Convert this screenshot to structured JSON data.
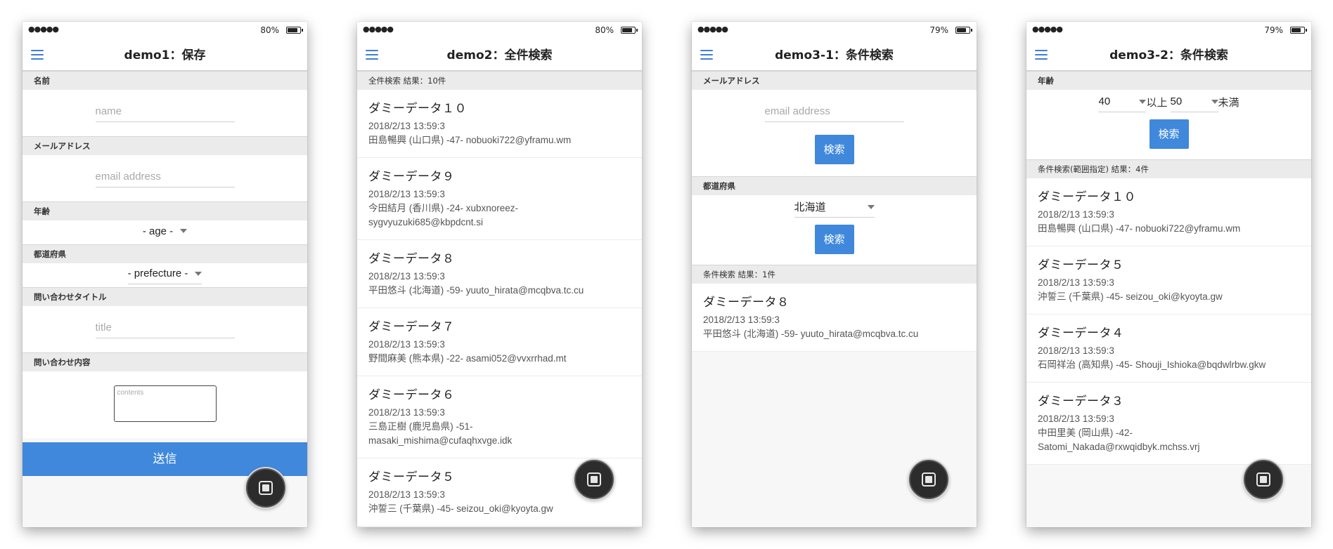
{
  "status": {
    "signal": "●●●●●"
  },
  "phones": [
    {
      "battery": "80%",
      "battery_level": 0.8,
      "title": "demo1：保存",
      "sections": {
        "name_label": "名前",
        "name_placeholder": "name",
        "email_label": "メールアドレス",
        "email_placeholder": "email address",
        "age_label": "年齢",
        "age_value": "- age -",
        "pref_label": "都道府県",
        "pref_value": "- prefecture -",
        "inq_title_label": "問い合わせタイトル",
        "inq_title_placeholder": "title",
        "inq_contents_label": "問い合わせ内容",
        "inq_contents_placeholder": "contents",
        "submit": "送信"
      }
    },
    {
      "battery": "80%",
      "battery_level": 0.8,
      "title": "demo2：全件検索",
      "result_header": "全件検索 結果：10件",
      "items": [
        {
          "name": "ダミーデータ１０",
          "date": "2018/2/13 13:59:3",
          "detail": "田島暢興 (山口県) -47- nobuoki722@yframu.wm"
        },
        {
          "name": "ダミーデータ９",
          "date": "2018/2/13 13:59:3",
          "detail": "今田結月 (香川県) -24- xubxnoreez-sygvyuzuki685@kbpdcnt.si"
        },
        {
          "name": "ダミーデータ８",
          "date": "2018/2/13 13:59:3",
          "detail": "平田悠斗 (北海道) -59- yuuto_hirata@mcqbva.tc.cu"
        },
        {
          "name": "ダミーデータ７",
          "date": "2018/2/13 13:59:3",
          "detail": "野間麻美 (熊本県) -22- asami052@vvxrrhad.mt"
        },
        {
          "name": "ダミーデータ６",
          "date": "2018/2/13 13:59:3",
          "detail": "三島正樹 (鹿児島県) -51- masaki_mishima@cufaqhxvge.idk"
        },
        {
          "name": "ダミーデータ５",
          "date": "2018/2/13 13:59:3",
          "detail": "沖誓三 (千葉県) -45- seizou_oki@kyoyta.gw"
        }
      ]
    },
    {
      "battery": "79%",
      "battery_level": 0.79,
      "title": "demo3-1：条件検索",
      "email_label": "メールアドレス",
      "email_placeholder": "email address",
      "search_btn": "検索",
      "pref_label": "都道府県",
      "pref_value": "北海道",
      "result_header": "条件検索 結果：1件",
      "items": [
        {
          "name": "ダミーデータ８",
          "date": "2018/2/13 13:59:3",
          "detail": "平田悠斗 (北海道) -59- yuuto_hirata@mcqbva.tc.cu"
        }
      ]
    },
    {
      "battery": "79%",
      "battery_level": 0.79,
      "title": "demo3-2：条件検索",
      "age_label": "年齢",
      "age_min": "40",
      "age_min_suffix": "以上",
      "age_max": "50",
      "age_max_suffix": "未満",
      "search_btn": "検索",
      "result_header": "条件検索(範囲指定) 結果：4件",
      "items": [
        {
          "name": "ダミーデータ１０",
          "date": "2018/2/13 13:59:3",
          "detail": "田島暢興 (山口県) -47- nobuoki722@yframu.wm"
        },
        {
          "name": "ダミーデータ５",
          "date": "2018/2/13 13:59:3",
          "detail": "沖誓三 (千葉県) -45- seizou_oki@kyoyta.gw"
        },
        {
          "name": "ダミーデータ４",
          "date": "2018/2/13 13:59:3",
          "detail": "石岡祥治 (高知県) -45- Shouji_Ishioka@bqdwlrbw.gkw"
        },
        {
          "name": "ダミーデータ３",
          "date": "2018/2/13 13:59:3",
          "detail": "中田里美 (岡山県) -42- Satomi_Nakada@rxwqidbyk.mchss.vrj"
        }
      ]
    }
  ]
}
